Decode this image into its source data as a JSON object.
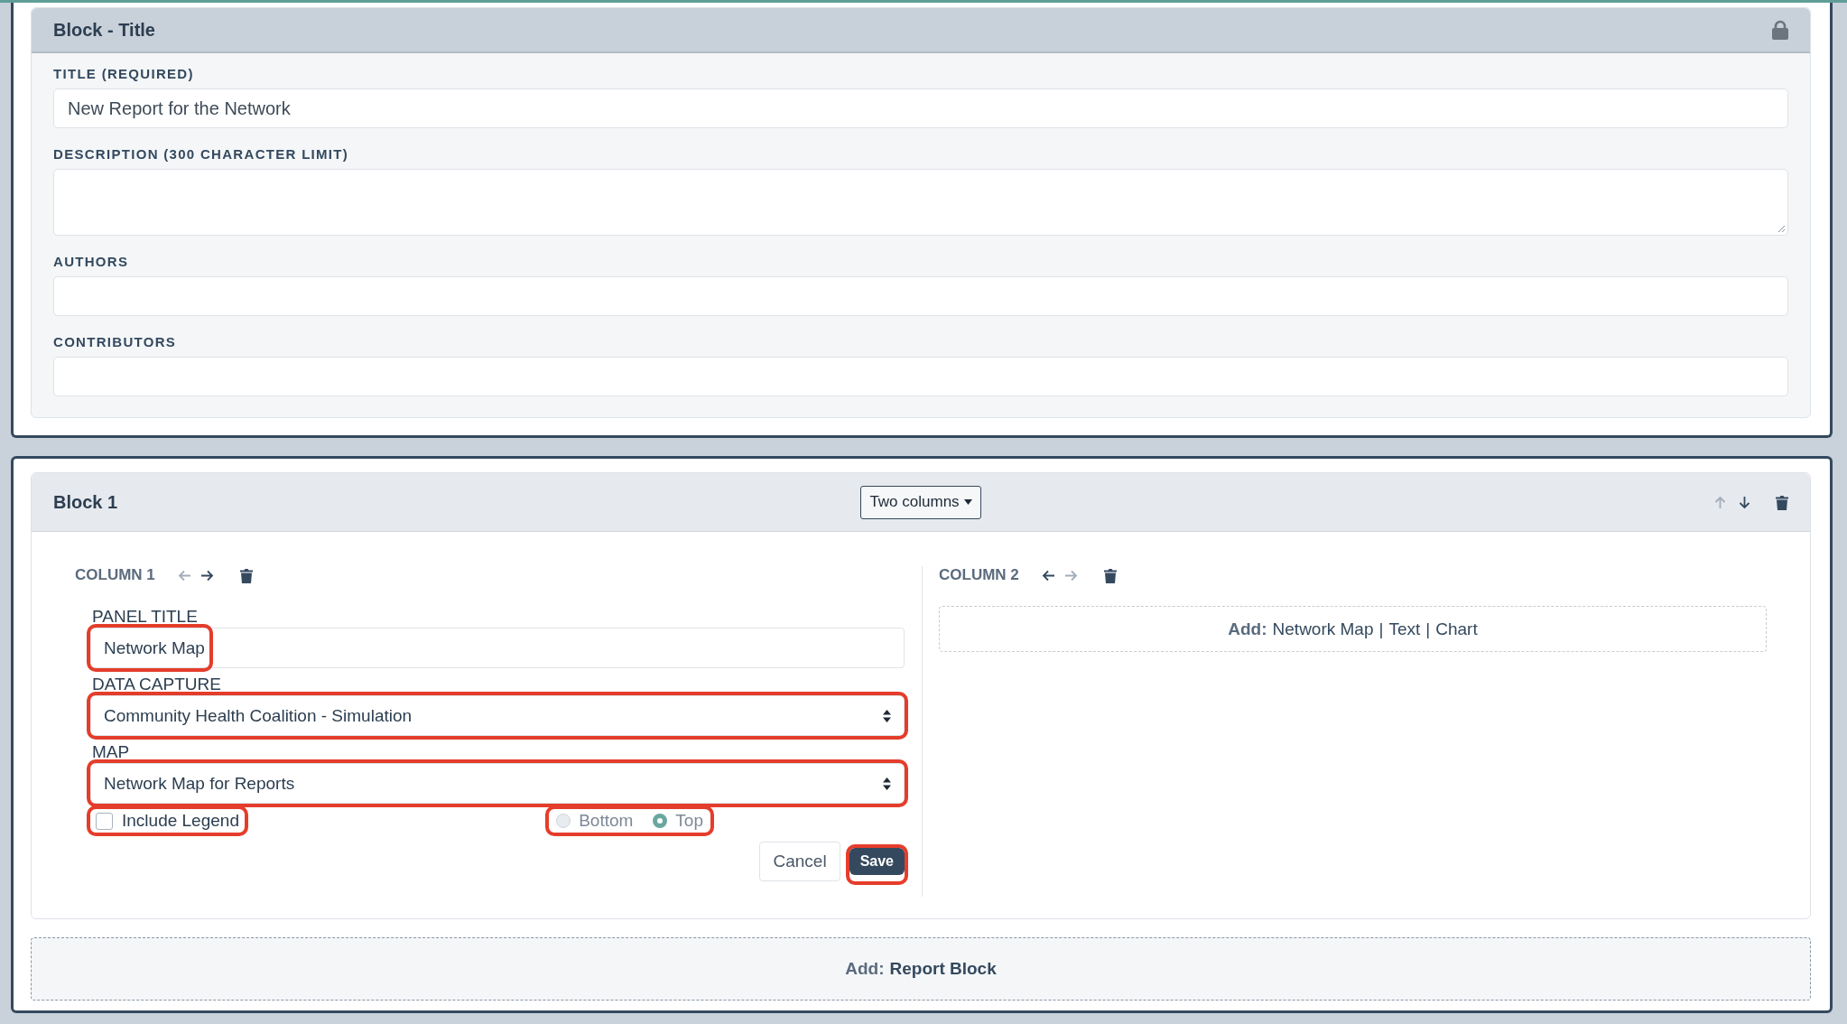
{
  "title_block": {
    "title": "Block - Title",
    "fields": [
      {
        "kind": "input",
        "label": "TITLE (REQUIRED)",
        "value": "New Report for the Network"
      },
      {
        "kind": "textarea",
        "label": "DESCRIPTION (300 CHARACTER LIMIT)"
      },
      {
        "kind": "input",
        "label": "AUTHORS"
      },
      {
        "kind": "input",
        "label": "CONTRIBUTORS"
      }
    ]
  },
  "blocks": [
    {
      "title": "Block 1",
      "layout": "Two columns",
      "move_up_disabled": true,
      "move_down_disabled": false,
      "columns": [
        {
          "heading": "COLUMN 1",
          "move_left_disabled": true,
          "move_right_disabled": false,
          "form": {
            "fields": [
              {
                "kind": "input",
                "label": "PANEL TITLE",
                "value": "Network Map",
                "highlighted": true
              },
              {
                "kind": "select",
                "label": "DATA CAPTURE",
                "value": "Community Health Coalition - Simulation",
                "highlighted": true
              },
              {
                "kind": "select",
                "label": "MAP",
                "value": "Network Map for Reports",
                "highlighted": true
              }
            ],
            "include_legend": {
              "label": "Include Legend",
              "checked": false,
              "highlighted": true
            },
            "legend_position": {
              "disabled": true,
              "highlighted": true,
              "options": [
                {
                  "label": "Bottom",
                  "selected": false
                },
                {
                  "label": "Top",
                  "selected": true
                }
              ]
            },
            "buttons": [
              {
                "kind": "secondary",
                "label": "Cancel",
                "highlighted": false
              },
              {
                "kind": "primary",
                "label": "Save",
                "highlighted": true
              }
            ]
          }
        },
        {
          "heading": "COLUMN 2",
          "move_left_disabled": false,
          "move_right_disabled": true,
          "add": {
            "prefix": "Add:",
            "separator": "|",
            "options": [
              "Network Map",
              "Text",
              "Chart"
            ]
          }
        }
      ]
    }
  ],
  "add_block": {
    "prefix": "Add:",
    "label": "Report Block"
  }
}
